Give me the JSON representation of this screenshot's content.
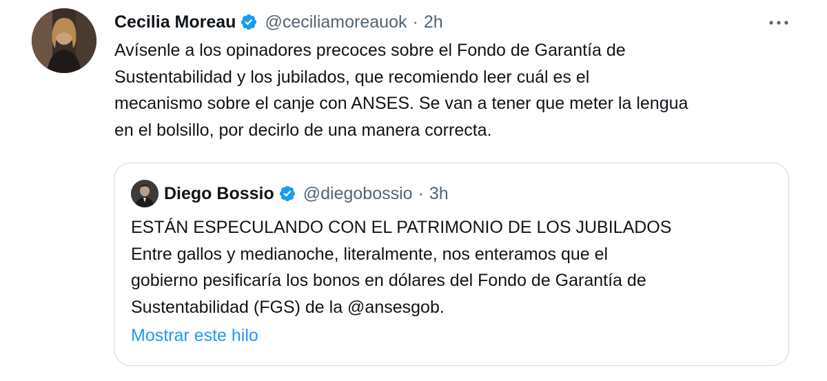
{
  "tweet": {
    "author": {
      "name": "Cecilia Moreau",
      "handle": "@ceciliamoreauok",
      "separator": "·",
      "time": "2h",
      "verified": true
    },
    "text_lines": [
      "Avísenle a los opinadores precoces sobre el Fondo de Garantía de",
      "Sustentabilidad y los jubilados, que recomiendo leer cuál es el",
      "mecanismo sobre el canje con ANSES. Se van a tener que meter la lengua",
      "en el bolsillo, por decirlo de una manera correcta."
    ],
    "more_icon": "more-horizontal-icon",
    "quoted": {
      "author": {
        "name": "Diego Bossio",
        "handle": "@diegobossio",
        "separator": "·",
        "time": "3h",
        "verified": true
      },
      "text_lines": [
        "ESTÁN ESPECULANDO CON EL PATRIMONIO DE LOS JUBILADOS",
        "Entre gallos y medianoche, literalmente, nos enteramos que el",
        "gobierno pesificaría los bonos en dólares del Fondo de Garantía de",
        "Sustentabilidad (FGS) de la @ansesgob."
      ],
      "show_thread_label": "Mostrar este hilo"
    }
  },
  "colors": {
    "text_primary": "#0f1419",
    "text_secondary": "#536471",
    "link": "#1d9bf0",
    "verified_badge": "#1d9bf0",
    "border": "#cfd9de"
  }
}
